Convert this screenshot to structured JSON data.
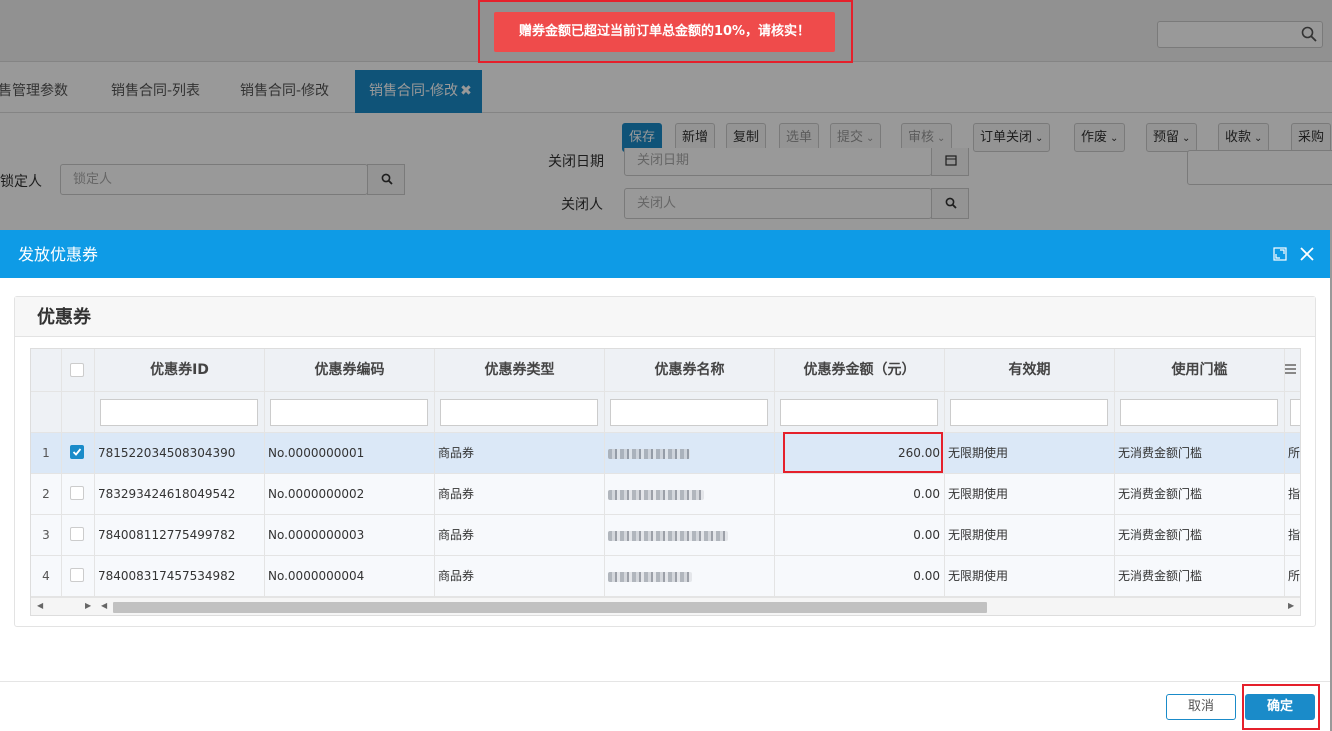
{
  "toast": {
    "message": "赠券金额已超过当前订单总金额的10%，请核实！"
  },
  "tabs": [
    {
      "label": "售管理参数"
    },
    {
      "label": "销售合同-列表"
    },
    {
      "label": "销售合同-修改"
    },
    {
      "label": "销售合同-修改",
      "close": "✖",
      "active": true
    }
  ],
  "toolbar": {
    "save": "保存",
    "new": "新增",
    "copy": "复制",
    "select": "选单",
    "submit": "提交",
    "audit": "审核",
    "close_order": "订单关闭",
    "void": "作废",
    "reserve": "预留",
    "collect": "收款",
    "purchase": "采购"
  },
  "form": {
    "locker_label": "锁定人",
    "locker_placeholder": "锁定人",
    "close_date_label": "关闭日期",
    "close_date_placeholder": "关闭日期",
    "closer_label": "关闭人",
    "closer_placeholder": "关闭人"
  },
  "modal": {
    "title": "发放优惠券",
    "panel_title": "优惠券",
    "cancel": "取消",
    "ok": "确定"
  },
  "grid": {
    "columns": [
      "优惠券ID",
      "优惠券编码",
      "优惠券类型",
      "优惠券名称",
      "优惠券金额（元）",
      "有效期",
      "使用门槛"
    ],
    "rows": [
      {
        "n": "1",
        "checked": true,
        "id": "781522034508304390",
        "code": "No.0000000001",
        "type": "商品券",
        "amount": "260.00",
        "validity": "无限期使用",
        "threshold": "无消费金额门槛",
        "extra": "所"
      },
      {
        "n": "2",
        "checked": false,
        "id": "783293424618049542",
        "code": "No.0000000002",
        "type": "商品券",
        "amount": "0.00",
        "validity": "无限期使用",
        "threshold": "无消费金额门槛",
        "extra": "指"
      },
      {
        "n": "3",
        "checked": false,
        "id": "784008112775499782",
        "code": "No.0000000003",
        "type": "商品券",
        "amount": "0.00",
        "validity": "无限期使用",
        "threshold": "无消费金额门槛",
        "extra": "指"
      },
      {
        "n": "4",
        "checked": false,
        "id": "784008317457534982",
        "code": "No.0000000004",
        "type": "商品券",
        "amount": "0.00",
        "validity": "无限期使用",
        "threshold": "无消费金额门槛",
        "extra": "所"
      }
    ]
  },
  "colors": {
    "accent": "#1a8bc9",
    "modal_header": "#0e9be6",
    "toast": "#ef4b4b",
    "highlight": "#e5202b"
  }
}
